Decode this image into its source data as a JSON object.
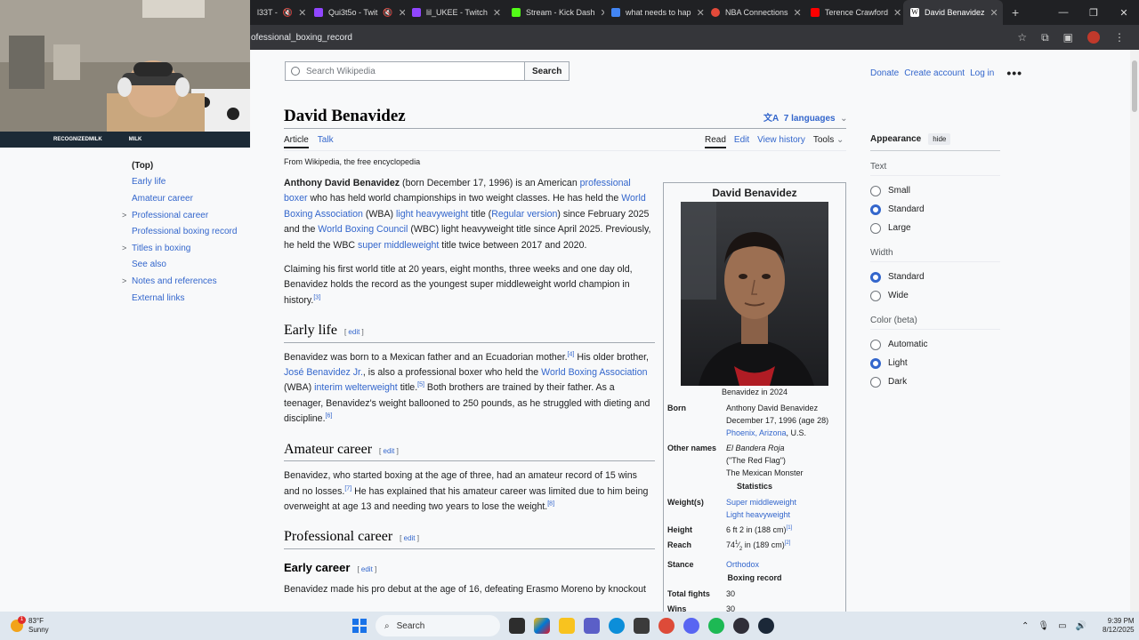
{
  "browser": {
    "tabs": [
      {
        "label": "l33T -",
        "color": "#ffffff",
        "muted": true
      },
      {
        "label": "Qui3t5o - Twit",
        "color": "#9146ff",
        "muted": true
      },
      {
        "label": "lil_UKEE - Twitch",
        "color": "#9146ff",
        "muted": false
      },
      {
        "label": "Stream - Kick Dash",
        "color": "#53fc18",
        "muted": false
      },
      {
        "label": "what needs to hap",
        "color": "#4285f4",
        "muted": false
      },
      {
        "label": "NBA Connections",
        "color": "#e34a3a",
        "muted": false
      },
      {
        "label": "Terence Crawford",
        "color": "#ff0000",
        "muted": false
      },
      {
        "label": "David Benavidez",
        "color": "#ffffff",
        "muted": false,
        "active": true
      }
    ],
    "url": "ofessional_boxing_record",
    "new_tab": "+"
  },
  "header": {
    "search_placeholder": "Search Wikipedia",
    "search_button": "Search",
    "donate": "Donate",
    "create_account": "Create account",
    "log_in": "Log in",
    "more": "•••"
  },
  "article": {
    "title": "David Benavidez",
    "languages": "7 languages",
    "tab_article": "Article",
    "tab_talk": "Talk",
    "tab_read": "Read",
    "tab_edit": "Edit",
    "tab_history": "View history",
    "tab_tools": "Tools",
    "from": "From Wikipedia, the free encyclopedia"
  },
  "toc": [
    {
      "label": "(Top)",
      "expandable": false
    },
    {
      "label": "Early life",
      "expandable": false
    },
    {
      "label": "Amateur career",
      "expandable": false
    },
    {
      "label": "Professional career",
      "expandable": true
    },
    {
      "label": "Professional boxing record",
      "expandable": false
    },
    {
      "label": "Titles in boxing",
      "expandable": true
    },
    {
      "label": "See also",
      "expandable": false
    },
    {
      "label": "Notes and references",
      "expandable": true
    },
    {
      "label": "External links",
      "expandable": false
    }
  ],
  "content": {
    "p1_bold": "Anthony David Benavidez",
    "p1_a": " (born December 17, 1996) is an American ",
    "p1_link1": "professional boxer",
    "p1_b": " who has held world championships in two weight classes. He has held the ",
    "p1_link2": "World Boxing Association",
    "p1_c": " (WBA) ",
    "p1_link3": "light heavyweight",
    "p1_d": " title (",
    "p1_link4": "Regular version",
    "p1_e": ") since February 2025 and the ",
    "p1_link5": "World Boxing Council",
    "p1_f": " (WBC) light heavyweight title since April 2025. Previously, he held the WBC ",
    "p1_link6": "super middleweight",
    "p1_g": " title twice between 2017 and 2020.",
    "p2": "Claiming his first world title at 20 years, eight months, three weeks and one day old, Benavidez holds the record as the youngest super middleweight world champion in history.",
    "p2_ref": "[3]",
    "h_early": "Early life",
    "edit": "edit",
    "p3_a": "Benavidez was born to a Mexican father and an Ecuadorian mother.",
    "p3_ref1": "[4]",
    "p3_b": " His older brother, ",
    "p3_link1": "José Benavidez Jr.",
    "p3_c": ", is also a professional boxer who held the ",
    "p3_link2": "World Boxing Association",
    "p3_d": " (WBA) ",
    "p3_link3": "interim welterweight",
    "p3_e": " title.",
    "p3_ref2": "[5]",
    "p3_f": " Both brothers are trained by their father. As a teenager, Benavidez's weight ballooned to 250 pounds, as he struggled with dieting and discipline.",
    "p3_ref3": "[6]",
    "h_amateur": "Amateur career",
    "p4_a": "Benavidez, who started boxing at the age of three, had an amateur record of 15 wins and no losses.",
    "p4_ref1": "[7]",
    "p4_b": " He has explained that his amateur career was limited due to him being overweight at age 13 and needing two years to lose the weight.",
    "p4_ref2": "[8]",
    "h_pro": "Professional career",
    "h_early_career": "Early career",
    "p5": "Benavidez made his pro debut at the age of 16, defeating Erasmo Moreno by knockout"
  },
  "infobox": {
    "title": "David Benavidez",
    "caption": "Benavidez in 2024",
    "born_k": "Born",
    "born_name": "Anthony David Benavidez",
    "born_date": "December 17, 1996 (age 28)",
    "born_place_link": "Phoenix, Arizona",
    "born_place_rest": ", U.S.",
    "other_k": "Other names",
    "other_1": "El Bandera Roja",
    "other_2": "(\"The Red Flag\")",
    "other_3": "The Mexican Monster",
    "stats_head": "Statistics",
    "weight_k": "Weight(s)",
    "weight_1": "Super middleweight",
    "weight_2": "Light heavyweight",
    "height_k": "Height",
    "height_v": "6 ft 2 in (188 cm)",
    "height_ref": "[1]",
    "reach_k": "Reach",
    "reach_a": "74",
    "reach_frac_num": "1",
    "reach_frac_den": "2",
    "reach_b": " in (189 cm)",
    "reach_ref": "[2]",
    "stance_k": "Stance",
    "stance_v": "Orthodox",
    "record_head": "Boxing record",
    "fights_k": "Total fights",
    "fights_v": "30",
    "wins_k": "Wins",
    "wins_v": "30"
  },
  "appearance": {
    "title": "Appearance",
    "hide": "hide",
    "text_label": "Text",
    "text_opts": [
      "Small",
      "Standard",
      "Large"
    ],
    "text_selected": "Standard",
    "width_label": "Width",
    "width_opts": [
      "Standard",
      "Wide"
    ],
    "width_selected": "Standard",
    "color_label": "Color (beta)",
    "color_opts": [
      "Automatic",
      "Light",
      "Dark"
    ],
    "color_selected": "Light"
  },
  "webcam": {
    "label_1": "RECOGNIZEDMILK",
    "label_2": "MILK"
  },
  "taskbar": {
    "temp": "83°F",
    "weather": "Sunny",
    "weather_badge": "1",
    "search": "Search",
    "time": "9:39 PM",
    "date": "8/12/2025"
  }
}
